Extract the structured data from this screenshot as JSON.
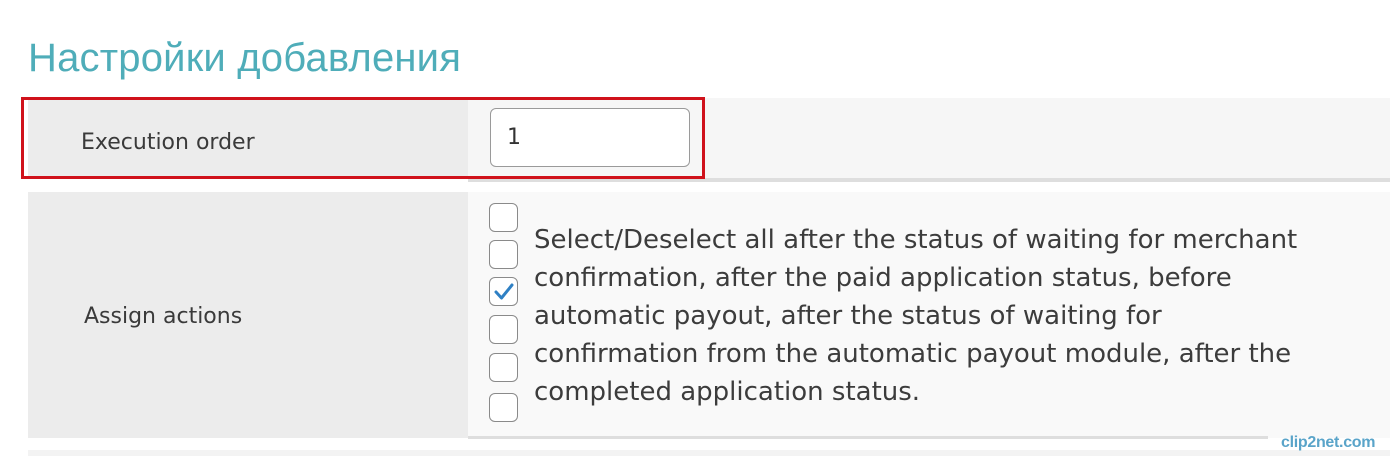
{
  "page": {
    "title": "Настройки добавления"
  },
  "fields": {
    "execution_order": {
      "label": "Execution order",
      "value": "1"
    },
    "assign_actions": {
      "label": "Assign actions",
      "checkboxes": [
        {
          "checked": false
        },
        {
          "checked": false
        },
        {
          "checked": true
        },
        {
          "checked": false
        },
        {
          "checked": false
        },
        {
          "checked": false
        }
      ],
      "description": "Select/Deselect all after the status of waiting for merchant confirmation, after the paid application status, before automatic payout, after the status of waiting for confirmation from the automatic payout module, after the completed application status."
    }
  },
  "colors": {
    "title": "#4fadb9",
    "highlight": "#d0121b",
    "checkmark": "#2f80c4"
  },
  "icons": {
    "checkmark": "check-icon"
  },
  "watermark": "clip2net.com"
}
